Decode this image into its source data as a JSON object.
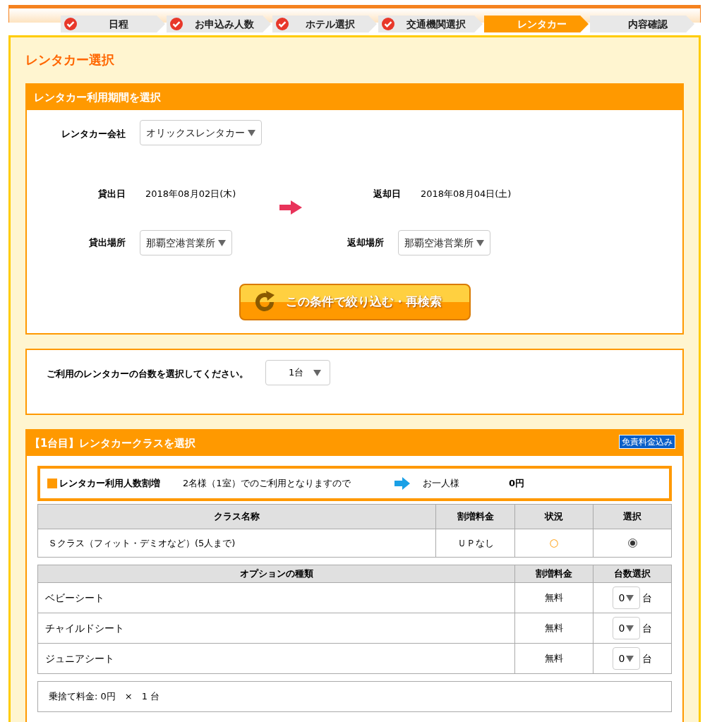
{
  "steps": [
    {
      "label": "日程",
      "done": true,
      "selected": false
    },
    {
      "label": "お申込み人数",
      "done": true,
      "selected": false
    },
    {
      "label": "ホテル選択",
      "done": true,
      "selected": false
    },
    {
      "label": "交通機関選択",
      "done": true,
      "selected": false
    },
    {
      "label": "レンタカー",
      "done": false,
      "selected": true
    },
    {
      "label": "内容確認",
      "done": false,
      "selected": false
    }
  ],
  "page_title": "レンタカー選択",
  "period": {
    "title": "レンタカー利用期間を選択",
    "company_label": "レンタカー会社",
    "company": "オリックスレンタカー",
    "pickup_date_label": "貸出日",
    "pickup_date": "2018年08月02日(木)",
    "return_date_label": "返却日",
    "return_date": "2018年08月04日(土)",
    "pickup_place_label": "貸出場所",
    "pickup_place": "那覇空港営業所",
    "return_place_label": "返却場所",
    "return_place": "那覇空港営業所",
    "search_button": "この条件で絞り込む・再検索"
  },
  "count": {
    "label": "ご利用のレンタカーの台数を選択してください。",
    "value": "1台"
  },
  "car_class": {
    "title": "【1台目】レンタカークラスを選択",
    "badge": "免責料金込み",
    "surcharge": {
      "label": "レンタカー利用人数割増",
      "note": "2名様（1室）でのご利用となりますので",
      "per_person": "お一人様",
      "amount": "0円"
    },
    "columns": [
      "クラス名称",
      "割増料金",
      "状況",
      "選択"
    ],
    "rows": [
      {
        "name": "Ｓクラス（フィット・デミオなど）(5人まで)",
        "surcharge": "ＵＰなし",
        "status": "○",
        "selected": true
      }
    ],
    "option_columns": [
      "オプションの種類",
      "割増料金",
      "台数選択"
    ],
    "options": [
      {
        "name": "ベビーシート",
        "price": "無料",
        "qty": "0",
        "unit": "台"
      },
      {
        "name": "チャイルドシート",
        "price": "無料",
        "qty": "0",
        "unit": "台"
      },
      {
        "name": "ジュニアシート",
        "price": "無料",
        "qty": "0",
        "unit": "台"
      }
    ],
    "dropoff": "乗捨て料金: 0円　×　1 台"
  }
}
